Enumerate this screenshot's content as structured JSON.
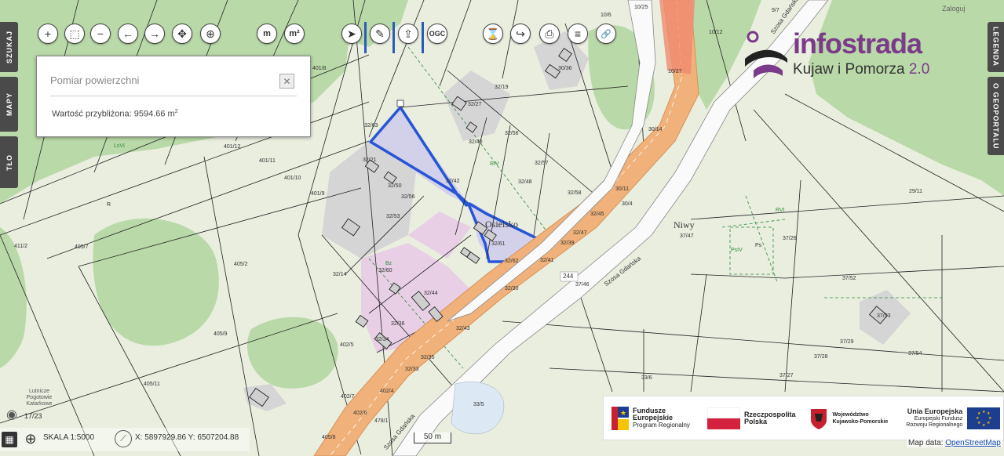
{
  "toolbar": {
    "zoom_in": "+",
    "zoom_box": "⬚",
    "zoom_out": "−",
    "back": "←",
    "forward": "→",
    "pan": "✥",
    "locate": "⊕",
    "measure_length": "m",
    "measure_area": "m²",
    "select": "➤",
    "draw": "✎",
    "export": "⇪",
    "ogc": "OGC",
    "hourglass": "⌛",
    "share": "↪",
    "print": "⎙",
    "layers": "≡",
    "link": "🔗"
  },
  "side_tabs": {
    "left": [
      "SZUKAJ",
      "MAPY",
      "TŁO"
    ],
    "right": [
      "LEGENDA",
      "O GEOPORTALU"
    ]
  },
  "login_label": "Zaloguj",
  "measure_panel": {
    "title": "Pomiar powierzchni",
    "close": "✕",
    "value_label": "Wartość przybliżona: 9594.66 m",
    "value_unit_sup": "2"
  },
  "logo": {
    "name": "infostrada",
    "subtitle": "Kujaw i Pomorza",
    "version": "2.0",
    "colors": {
      "purple": "#7b3a8a",
      "dark": "#222222"
    }
  },
  "map": {
    "place_labels": [
      "Osielsko",
      "Niwy"
    ],
    "road_labels": [
      "Szosa Gdańska",
      "Szosa Gdańska",
      "Szosa Gdańska",
      "244"
    ],
    "parcel_labels": [
      "10/6",
      "10/25",
      "10/12",
      "10/27",
      "9/7",
      "30/36",
      "30/14",
      "32/19",
      "32/27",
      "32/40",
      "32/56",
      "32/57",
      "32/48",
      "32/58",
      "32/42",
      "32/63",
      "32/21",
      "32/50",
      "32/56",
      "32/53",
      "32/61",
      "32/62",
      "32/41",
      "32/39",
      "32/47",
      "32/45",
      "30/11",
      "32/14",
      "32/60",
      "32/30",
      "32/44",
      "32/43",
      "32/36",
      "32/34",
      "32/33",
      "32/35",
      "37/47",
      "37/46",
      "37/26",
      "37/52",
      "37/53",
      "37/29",
      "37/28",
      "37/27",
      "37/54",
      "29/11",
      "401/12",
      "401/11",
      "401/10",
      "401/9",
      "401/8",
      "405/7",
      "411/2",
      "405/2",
      "405/9",
      "405/11",
      "402/5",
      "402/4",
      "402/7",
      "402/6",
      "478/1",
      "405/8",
      "33/5",
      "33/6",
      "30/4",
      "R",
      "Ps",
      "PsIV",
      "RVI",
      "LsVI",
      "Bz",
      "RIV"
    ],
    "corner_text": "Lutnicze Pogotowie Katarkowe",
    "corner_number": "17/23",
    "colors": {
      "base": "#e9eedf",
      "forest": "#b9d9a8",
      "built": "#d6d6d6",
      "residential": "#e8cfe6",
      "road_main": "#f0b27a",
      "road_edge": "#d9915a",
      "highlight_fill": "#c9c3ec",
      "highlight_stroke": "#2855d6",
      "parcel_line": "#222222",
      "use_line": "#2f8a3a"
    }
  },
  "bottom": {
    "scale_label": "SKALA 1:5000",
    "coords": "X: 5897929.86  Y: 6507204.88",
    "scalebar_label": "50 m"
  },
  "eu_logos": {
    "fe_title": "Fundusze",
    "fe_title2": "Europejskie",
    "fe_sub": "Program Regionalny",
    "rp_title": "Rzeczpospolita",
    "rp_title2": "Polska",
    "woj_title": "Województwo",
    "woj_title2": "Kujawsko-Pomorskie",
    "ue_title": "Unia Europejska",
    "ue_sub1": "Europejski Fundusz",
    "ue_sub2": "Rozwoju Regionalnego"
  },
  "attribution": {
    "prefix": "Map data: ",
    "link": "OpenStreetMap"
  }
}
